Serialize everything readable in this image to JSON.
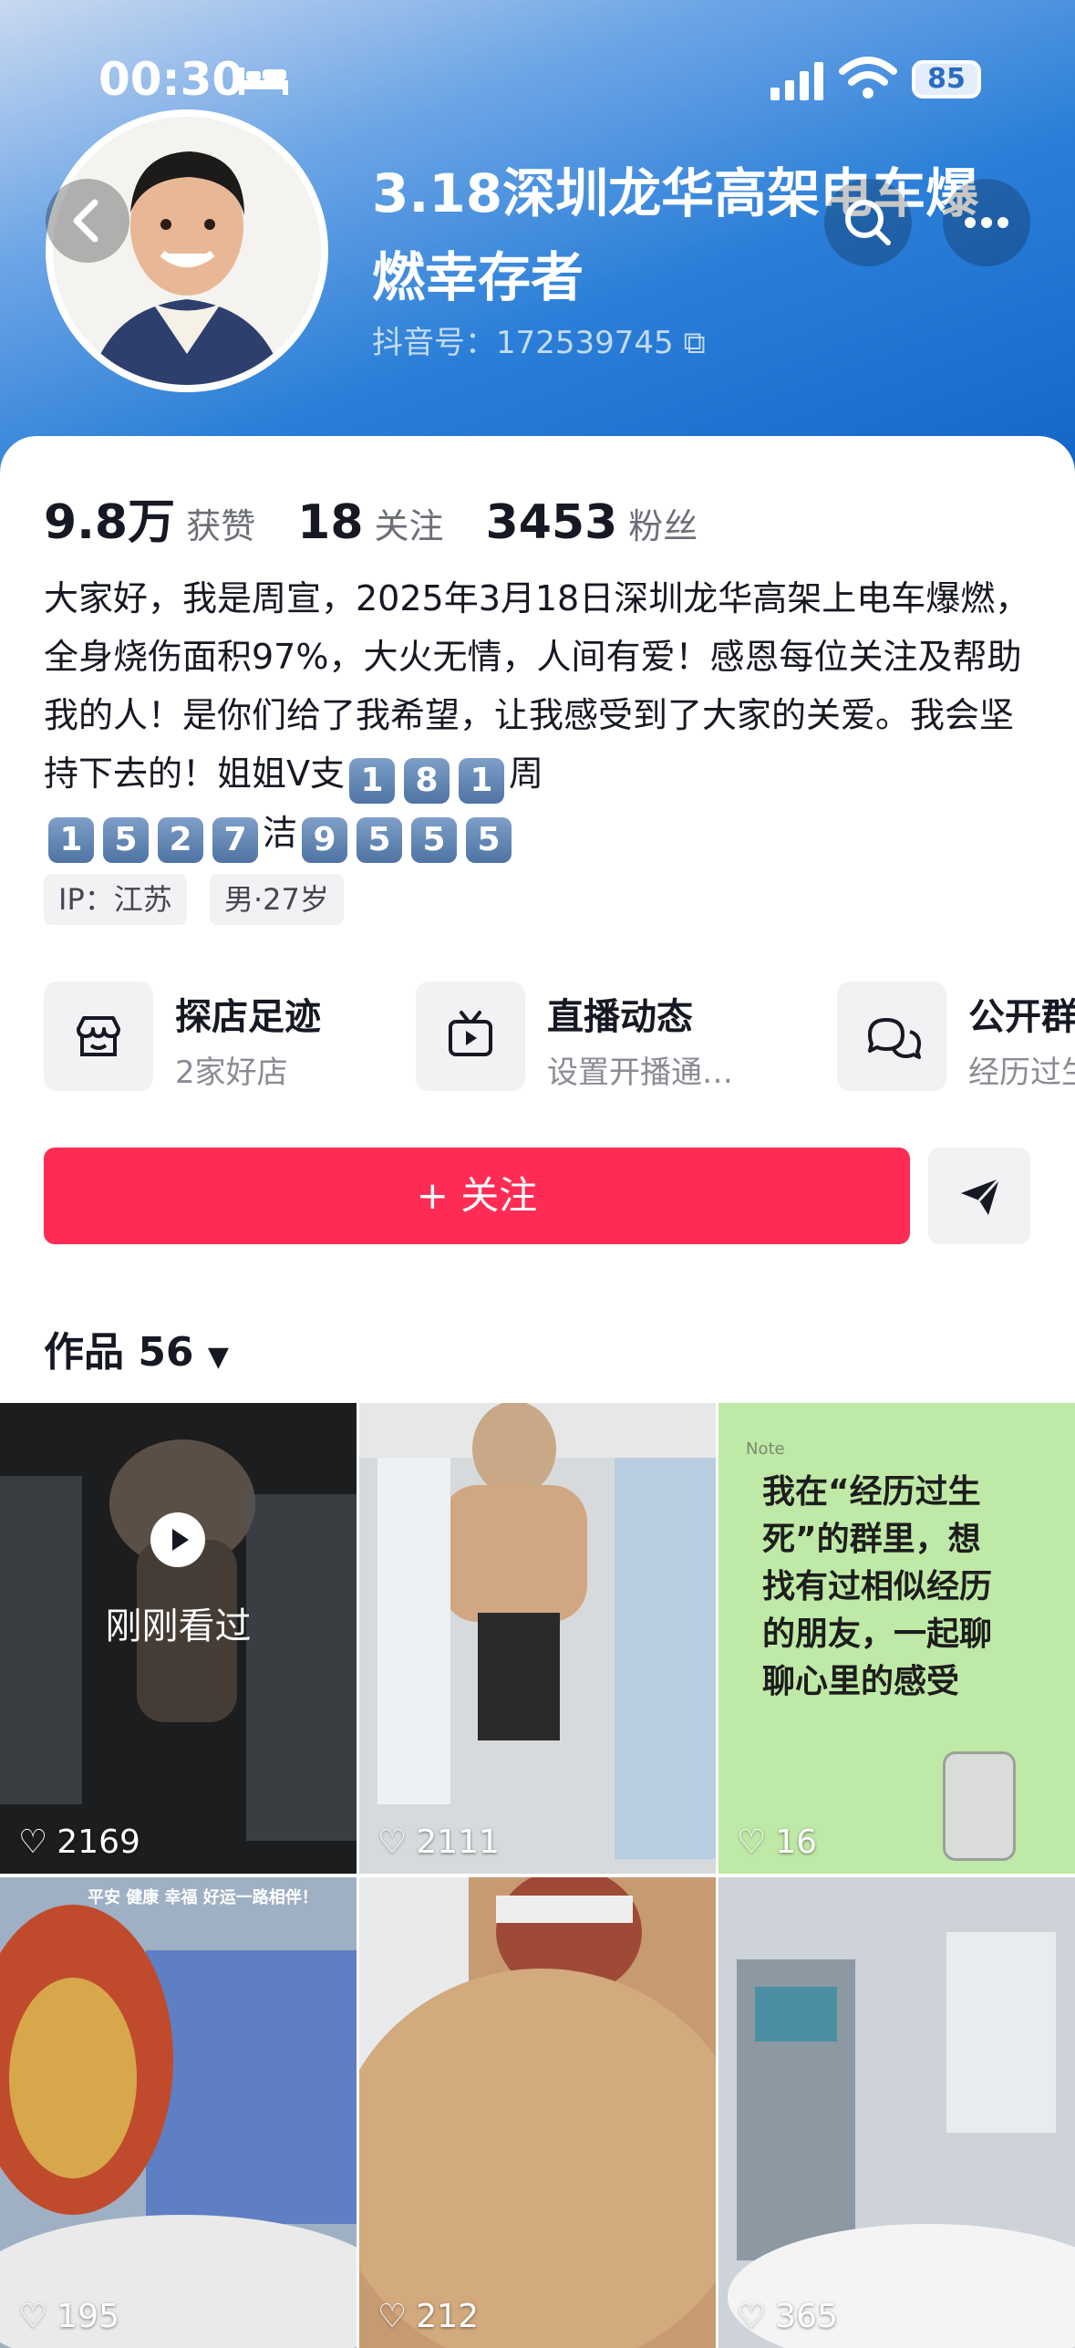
{
  "status": {
    "time": "00:30",
    "battery": "85"
  },
  "profile": {
    "name": "3.18深圳龙华高架电车爆燃幸存者",
    "douyin_id": "抖音号：172539745"
  },
  "stats": {
    "likes": "9.8万",
    "likes_label": "获赞",
    "following": "18",
    "following_label": "关注",
    "fans": "3453",
    "fans_label": "粉丝"
  },
  "bio": {
    "text": "大家好，我是周宣，2025年3月18日深圳龙华高架上电车爆燃，全身烧伤面积97%，大火无情，人间有爱！感恩每位关注及帮助我的人！是你们给了我希望，让我感受到了大家的关爱。我会坚持下去的！姐姐V支",
    "keys_a": [
      "1",
      "8",
      "1"
    ],
    "mid": "周",
    "keys_b": [
      "1",
      "5",
      "2",
      "7"
    ],
    "mid2": "洁",
    "keys_c": [
      "9",
      "5",
      "5",
      "5"
    ]
  },
  "tags": {
    "ip": "IP：江苏",
    "gender_age": "男·27岁"
  },
  "services": [
    {
      "title": "探店足迹",
      "sub": "2家好店",
      "icon": "shop-icon"
    },
    {
      "title": "直播动态",
      "sub": "设置开播通…",
      "icon": "live-tv-icon"
    },
    {
      "title": "公开群",
      "sub": "经历过生",
      "icon": "group-chat-icon"
    }
  ],
  "actions": {
    "follow": "+ 关注"
  },
  "works": {
    "label": "作品 56"
  },
  "videos": [
    {
      "likes": "2169",
      "overlay": "刚刚看过",
      "bg": "#3a3b3d"
    },
    {
      "likes": "2111",
      "bg": "#cfd2d4"
    },
    {
      "likes": "16",
      "note": "Note",
      "lines": [
        "我在“经历过生",
        "死”的群里，想",
        "找有过相似经历",
        "的朋友，一起聊",
        "聊心里的感受"
      ],
      "bg": "#bfe9a6"
    },
    {
      "likes": "195",
      "banner": "平安 健康 幸福 好运一路相伴！",
      "bg": "#b9c3cf"
    },
    {
      "likes": "212",
      "bg": "#c9a079"
    },
    {
      "likes": "365",
      "bg": "#d8dde1"
    }
  ]
}
